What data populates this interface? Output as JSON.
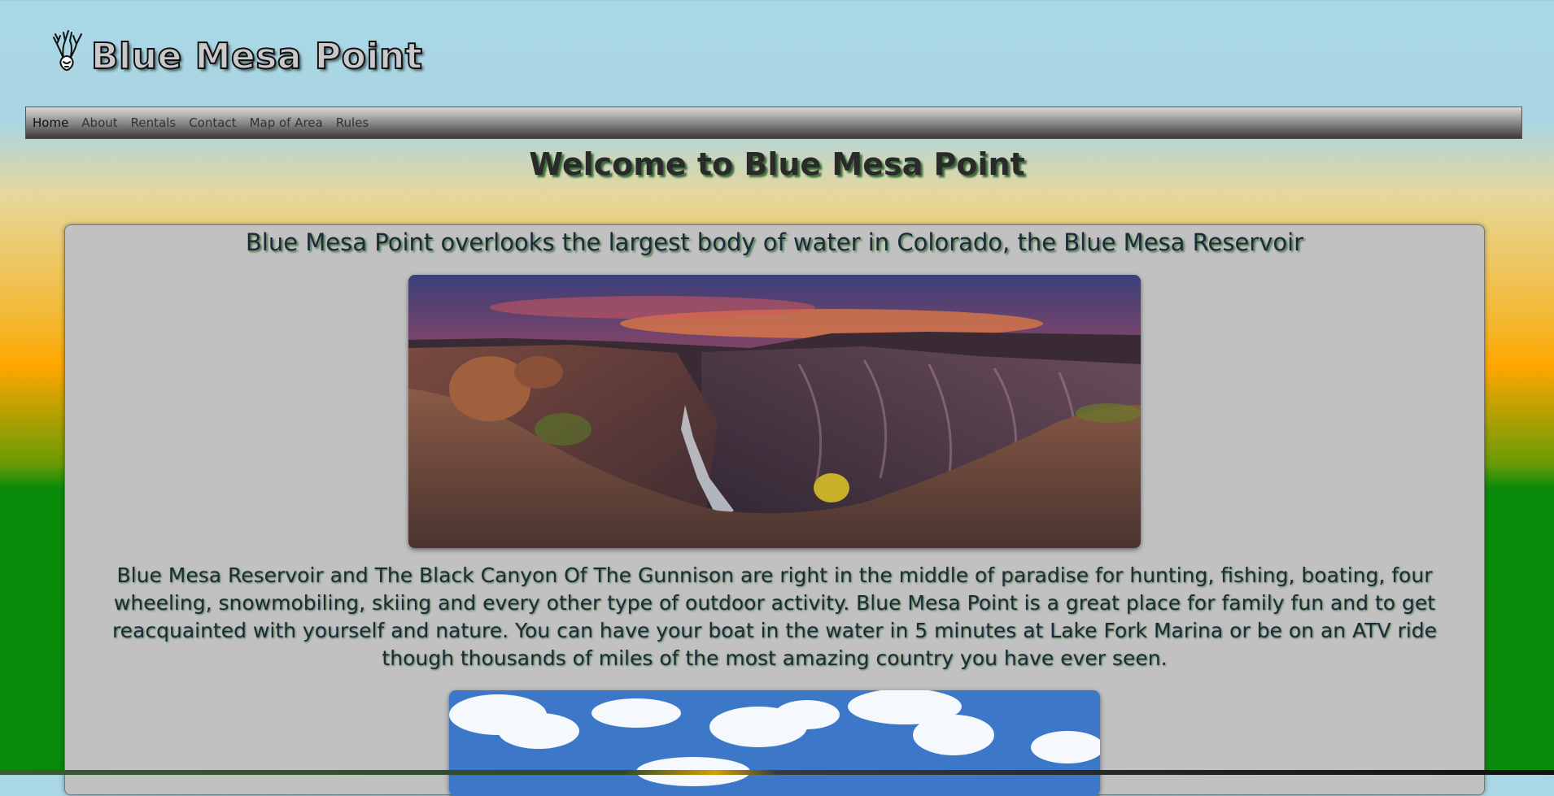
{
  "site": {
    "title": "Blue Mesa Point",
    "logo_icon": "deer-head-icon"
  },
  "nav": {
    "items": [
      {
        "label": "Home",
        "active": true
      },
      {
        "label": "About",
        "active": false
      },
      {
        "label": "Rentals",
        "active": false
      },
      {
        "label": "Contact",
        "active": false
      },
      {
        "label": "Map of Area",
        "active": false
      },
      {
        "label": "Rules",
        "active": false
      }
    ]
  },
  "main": {
    "welcome": "Welcome to Blue Mesa Point",
    "heading": "Blue Mesa Point overlooks the largest body of water in Colorado, the Blue Mesa Reservoir",
    "paragraph": "Blue Mesa Reservoir and The Black Canyon Of The Gunnison are right in the middle of paradise for hunting, fishing, boating, four wheeling, snowmobiling, skiing and every other type of outdoor activity. Blue Mesa Point is a great place for family fun and to get reacquainted with yourself and nature. You can have your boat in the water in 5 minutes at Lake Fork Marina or be on an ATV ride though thousands of miles of the most amazing country you have ever seen."
  },
  "colors": {
    "sky": "#a9d7e6",
    "orange": "#ffa600",
    "green": "#0a8a0a",
    "panel": "#c1c1c1"
  }
}
